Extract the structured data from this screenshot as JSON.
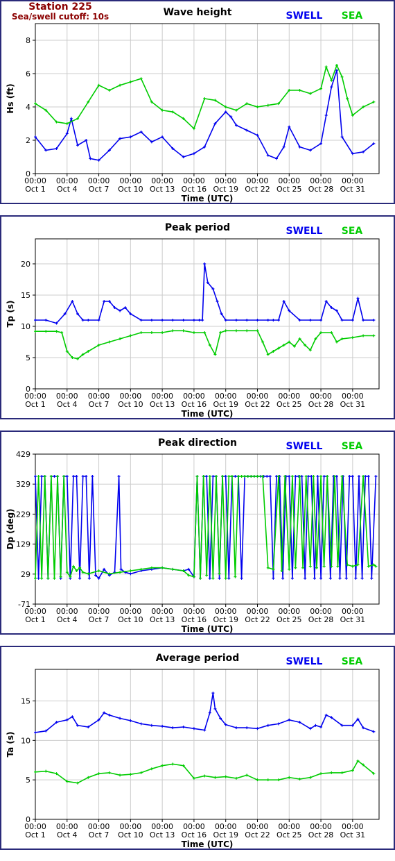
{
  "station": {
    "title": "Station 225",
    "subtitle": "Sea/swell cutoff: 10s"
  },
  "colors": {
    "swell": "#0000ee",
    "sea": "#00cc00",
    "frame": "#2a2a7a",
    "station": "#8b0000"
  },
  "legend": {
    "swell": "SWELL",
    "sea": "SEA"
  },
  "x_axis": {
    "label": "Time (UTC)",
    "range_days": [
      0,
      32.5
    ],
    "ticks": [
      {
        "day": 0,
        "time": "00:00",
        "date": "Oct 1"
      },
      {
        "day": 3,
        "time": "00:00",
        "date": "Oct 4"
      },
      {
        "day": 6,
        "time": "00:00",
        "date": "Oct 7"
      },
      {
        "day": 9,
        "time": "00:00",
        "date": "Oct 10"
      },
      {
        "day": 12,
        "time": "00:00",
        "date": "Oct 13"
      },
      {
        "day": 15,
        "time": "00:00",
        "date": "Oct 16"
      },
      {
        "day": 18,
        "time": "00:00",
        "date": "Oct 19"
      },
      {
        "day": 21,
        "time": "00:00",
        "date": "Oct 22"
      },
      {
        "day": 24,
        "time": "00:00",
        "date": "Oct 25"
      },
      {
        "day": 27,
        "time": "00:00",
        "date": "Oct 28"
      },
      {
        "day": 30,
        "time": "00:00",
        "date": "Oct 31"
      }
    ]
  },
  "chart_data": [
    {
      "type": "line",
      "title": "Wave height",
      "ylabel": "Hs (ft)",
      "ylim": [
        0,
        9
      ],
      "yticks": [
        "0",
        "2",
        "4",
        "6",
        "8"
      ],
      "ytick_values": [
        0,
        2,
        4,
        6,
        8
      ],
      "grid": true,
      "legend_position": "top-right",
      "series": [
        {
          "name": "SWELL",
          "x": [
            0,
            1,
            2,
            3,
            3.4,
            4,
            4.8,
            5.2,
            6,
            7,
            8,
            9,
            10,
            11,
            12,
            13,
            14,
            15,
            16,
            17,
            18,
            18.5,
            19,
            20,
            21,
            22,
            22.8,
            23.5,
            24,
            25,
            26,
            27,
            27.5,
            28,
            28.5,
            29,
            30,
            31,
            32
          ],
          "values": [
            2.2,
            1.4,
            1.5,
            2.4,
            3.3,
            1.7,
            2.0,
            0.9,
            0.8,
            1.4,
            2.1,
            2.2,
            2.5,
            1.9,
            2.2,
            1.5,
            1.0,
            1.2,
            1.6,
            3.0,
            3.7,
            3.4,
            2.9,
            2.6,
            2.3,
            1.1,
            0.9,
            1.6,
            2.8,
            1.6,
            1.4,
            1.8,
            3.5,
            5.2,
            6.2,
            2.2,
            1.2,
            1.3,
            1.8
          ]
        },
        {
          "name": "SEA",
          "x": [
            0,
            1,
            2,
            3,
            4,
            5,
            6,
            7,
            8,
            9,
            10,
            11,
            12,
            13,
            14,
            15,
            16,
            17,
            18,
            19,
            20,
            21,
            22,
            23,
            24,
            25,
            26,
            27,
            27.5,
            28,
            28.5,
            29,
            29.5,
            30,
            31,
            32
          ],
          "values": [
            4.2,
            3.8,
            3.1,
            3.0,
            3.3,
            4.3,
            5.3,
            5.0,
            5.3,
            5.5,
            5.7,
            4.3,
            3.8,
            3.7,
            3.3,
            2.7,
            4.5,
            4.4,
            4.0,
            3.8,
            4.2,
            4.0,
            4.1,
            4.2,
            5.0,
            5.0,
            4.8,
            5.1,
            6.4,
            5.6,
            6.5,
            5.8,
            4.5,
            3.5,
            4.0,
            4.3
          ]
        }
      ]
    },
    {
      "type": "line",
      "title": "Peak period",
      "ylabel": "Tp (s)",
      "ylim": [
        0,
        24
      ],
      "yticks": [
        "0",
        "5",
        "10",
        "15",
        "20"
      ],
      "ytick_values": [
        0,
        5,
        10,
        15,
        20
      ],
      "grid": true,
      "legend_position": "top-right",
      "series": [
        {
          "name": "SWELL",
          "x": [
            0,
            1,
            2,
            2.8,
            3.5,
            4,
            4.5,
            5,
            6,
            6.5,
            7,
            7.5,
            8,
            8.5,
            9,
            10,
            11,
            12,
            13,
            14,
            15,
            15.5,
            15.8,
            16,
            16.3,
            16.8,
            17.2,
            17.6,
            18,
            19,
            20,
            21,
            22,
            22.5,
            23,
            23.5,
            24,
            25,
            26,
            27,
            27.5,
            28,
            28.5,
            29,
            30,
            30.5,
            31,
            32
          ],
          "values": [
            11,
            11,
            10.5,
            12,
            14,
            12,
            11,
            11,
            11,
            14,
            14,
            13,
            12.5,
            13,
            12,
            11,
            11,
            11,
            11,
            11,
            11,
            11,
            11,
            20,
            17,
            16,
            14,
            12,
            11,
            11,
            11,
            11,
            11,
            11,
            11,
            14,
            12.5,
            11,
            11,
            11,
            14,
            13,
            12.5,
            11,
            11,
            14.5,
            11,
            11
          ]
        },
        {
          "name": "SEA",
          "x": [
            0,
            1,
            2,
            2.5,
            3,
            3.5,
            4,
            4.5,
            5,
            6,
            7,
            8,
            9,
            10,
            11,
            12,
            13,
            14,
            15,
            16,
            16.5,
            17,
            17.5,
            18,
            19,
            20,
            21,
            21.5,
            22,
            22.5,
            23,
            23.5,
            24,
            24.5,
            25,
            25.5,
            26,
            26.5,
            27,
            28,
            28.5,
            29,
            30,
            31,
            32
          ],
          "values": [
            9.2,
            9.2,
            9.2,
            9,
            6,
            5,
            4.8,
            5.5,
            6,
            7,
            7.5,
            8,
            8.5,
            9,
            9,
            9,
            9.3,
            9.3,
            9,
            9,
            7,
            5.5,
            9,
            9.3,
            9.3,
            9.3,
            9.3,
            7.5,
            5.5,
            6,
            6.5,
            7,
            7.5,
            6.8,
            8,
            7,
            6.2,
            8,
            9,
            9,
            7.5,
            8,
            8.2,
            8.5,
            8.5
          ]
        }
      ]
    },
    {
      "type": "line",
      "title": "Peak direction",
      "ylabel": "Dp (deg)",
      "ylim": [
        -71,
        429
      ],
      "yticks": [
        "-71",
        "29",
        "129",
        "229",
        "329",
        "429"
      ],
      "ytick_values": [
        -71,
        29,
        129,
        229,
        329,
        429
      ],
      "grid": true,
      "legend_position": "top-right",
      "series": [
        {
          "name": "SWELL",
          "x": [
            0,
            0.3,
            0.6,
            0.9,
            1.2,
            1.5,
            1.8,
            2.1,
            2.4,
            2.7,
            3,
            3.3,
            3.6,
            3.9,
            4.2,
            4.5,
            4.8,
            5.1,
            5.4,
            5.7,
            6,
            6.5,
            7,
            7.5,
            7.9,
            8.1,
            8.5,
            9,
            10,
            11,
            12,
            13,
            14,
            14.5,
            15,
            15.3,
            15.6,
            15.9,
            16.2,
            16.5,
            16.8,
            17.1,
            17.4,
            17.7,
            18,
            18.3,
            18.6,
            18.9,
            19.2,
            19.5,
            19.8,
            20.1,
            20.4,
            20.7,
            21,
            21.3,
            21.6,
            21.9,
            22.2,
            22.5,
            22.8,
            23.1,
            23.4,
            23.7,
            24,
            24.3,
            24.6,
            24.9,
            25.2,
            25.5,
            25.8,
            26.1,
            26.4,
            26.7,
            27,
            27.3,
            27.6,
            27.9,
            28.2,
            28.5,
            28.8,
            29.1,
            29.4,
            29.7,
            30,
            30.3,
            30.6,
            30.9,
            31.2,
            31.5,
            31.8,
            32.2
          ],
          "values": [
            355,
            15,
            355,
            355,
            15,
            355,
            355,
            355,
            15,
            355,
            355,
            15,
            355,
            355,
            15,
            355,
            355,
            15,
            355,
            25,
            15,
            45,
            25,
            35,
            355,
            45,
            35,
            30,
            40,
            45,
            50,
            45,
            40,
            45,
            20,
            355,
            15,
            355,
            355,
            15,
            355,
            355,
            15,
            355,
            355,
            15,
            355,
            355,
            355,
            15,
            355,
            355,
            355,
            355,
            355,
            355,
            355,
            355,
            355,
            15,
            355,
            355,
            15,
            355,
            355,
            15,
            355,
            355,
            355,
            15,
            355,
            355,
            15,
            355,
            15,
            355,
            355,
            15,
            355,
            355,
            15,
            355,
            15,
            355,
            355,
            15,
            355,
            15,
            355,
            355,
            15,
            355
          ]
        },
        {
          "name": "SEA",
          "x": [
            0,
            0.3,
            0.6,
            0.9,
            1.2,
            1.5,
            1.8,
            2.1,
            2.4,
            2.7,
            3,
            3.3,
            3.6,
            3.9,
            4.2,
            4.5,
            5,
            6,
            7,
            8,
            9,
            10,
            11,
            12,
            13,
            14,
            14.5,
            15,
            15.3,
            15.6,
            15.9,
            16.2,
            16.5,
            16.8,
            17.1,
            17.4,
            17.7,
            18,
            18.3,
            18.6,
            18.9,
            19.2,
            19.5,
            19.8,
            20.1,
            20.4,
            20.7,
            21,
            21.5,
            22,
            22.5,
            23,
            23.3,
            23.6,
            24,
            24.3,
            24.6,
            25,
            25.3,
            25.6,
            26,
            26.3,
            26.6,
            27,
            27.3,
            27.6,
            28,
            28.3,
            28.6,
            29,
            29.5,
            30,
            30.5,
            31,
            31.5,
            32,
            32.2
          ],
          "values": [
            15,
            355,
            15,
            355,
            15,
            355,
            15,
            355,
            20,
            355,
            35,
            20,
            55,
            40,
            50,
            35,
            30,
            40,
            30,
            35,
            40,
            45,
            50,
            50,
            45,
            40,
            25,
            20,
            355,
            15,
            355,
            25,
            355,
            15,
            355,
            30,
            355,
            15,
            355,
            355,
            20,
            355,
            355,
            355,
            355,
            355,
            355,
            355,
            355,
            50,
            45,
            355,
            40,
            355,
            45,
            355,
            50,
            355,
            50,
            355,
            55,
            355,
            50,
            355,
            55,
            355,
            55,
            355,
            55,
            355,
            60,
            55,
            60,
            355,
            55,
            60,
            55
          ]
        }
      ]
    },
    {
      "type": "line",
      "title": "Average period",
      "ylabel": "Ta (s)",
      "ylim": [
        0,
        19
      ],
      "yticks": [
        "0",
        "5",
        "10",
        "15"
      ],
      "ytick_values": [
        0,
        5,
        10,
        15
      ],
      "grid": true,
      "legend_position": "top-right",
      "series": [
        {
          "name": "SWELL",
          "x": [
            0,
            1,
            2,
            3,
            3.5,
            4,
            5,
            6,
            6.5,
            7,
            8,
            9,
            10,
            11,
            12,
            13,
            14,
            15,
            16,
            16.5,
            16.8,
            17,
            17.5,
            18,
            19,
            20,
            21,
            22,
            23,
            24,
            25,
            26,
            26.5,
            27,
            27.5,
            28,
            29,
            30,
            30.5,
            31,
            32
          ],
          "values": [
            11,
            11.2,
            12.3,
            12.6,
            13,
            11.9,
            11.7,
            12.6,
            13.5,
            13.2,
            12.8,
            12.5,
            12.1,
            11.9,
            11.8,
            11.6,
            11.7,
            11.5,
            11.3,
            13.5,
            16,
            14,
            12.8,
            12,
            11.6,
            11.6,
            11.5,
            11.9,
            12.1,
            12.6,
            12.3,
            11.5,
            11.9,
            11.7,
            13.2,
            12.9,
            11.9,
            11.9,
            12.7,
            11.6,
            11.1
          ]
        },
        {
          "name": "SEA",
          "x": [
            0,
            1,
            2,
            3,
            4,
            5,
            6,
            7,
            8,
            9,
            10,
            11,
            12,
            13,
            14,
            15,
            16,
            17,
            18,
            19,
            20,
            21,
            22,
            23,
            24,
            25,
            26,
            27,
            28,
            29,
            30,
            30.5,
            31,
            32
          ],
          "values": [
            6,
            6.1,
            5.8,
            4.8,
            4.6,
            5.3,
            5.8,
            5.9,
            5.6,
            5.7,
            5.9,
            6.4,
            6.8,
            7,
            6.8,
            5.2,
            5.5,
            5.3,
            5.4,
            5.2,
            5.6,
            5,
            5,
            5,
            5.3,
            5.1,
            5.3,
            5.8,
            5.9,
            5.9,
            6.2,
            7.4,
            6.9,
            5.8
          ]
        }
      ]
    }
  ]
}
